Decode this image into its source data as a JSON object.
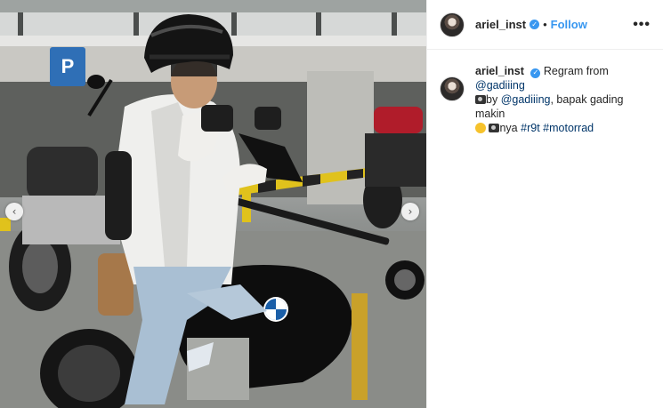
{
  "post": {
    "author": "ariel_inst",
    "separator": "•",
    "follow_label": "Follow",
    "more_label": "•••"
  },
  "caption": {
    "author": "ariel_inst",
    "regram_text": "Regram from",
    "regram_handle": "@gadiiing",
    "by_text": "by",
    "by_handle": "@gadiiing",
    "text_1": ", bapak gading makin",
    "text_2": "nya",
    "hashtag_1": "#r9t",
    "hashtag_2": "#motorrad"
  },
  "photo": {
    "parking_sign": "P",
    "arrow_left": "‹",
    "arrow_right": "›"
  },
  "colors": {
    "accent": "#3897f0",
    "link": "#003569",
    "text": "#262626"
  }
}
